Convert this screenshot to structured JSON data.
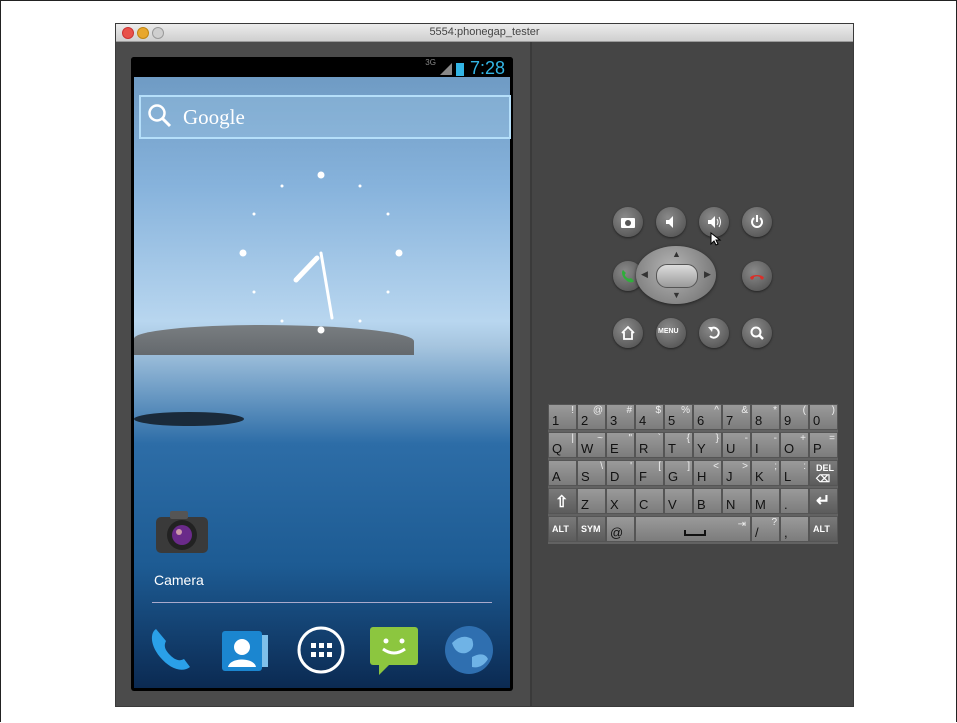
{
  "window": {
    "title": "5554:phonegap_tester"
  },
  "statusbar": {
    "network": "3G",
    "time": "7:28"
  },
  "search": {
    "label": "Google"
  },
  "desktop": {
    "camera_label": "Camera"
  },
  "dock": {
    "items": [
      "phone-icon",
      "contacts-icon",
      "all-apps-icon",
      "messaging-icon",
      "browser-icon"
    ]
  },
  "controls": {
    "menu_label": "MENU",
    "buttons": [
      "camera-icon",
      "volume-down-icon",
      "volume-up-icon",
      "power-icon",
      "call-icon",
      "end-call-icon",
      "home-icon",
      "menu",
      "back-icon",
      "search-icon"
    ]
  },
  "keyboard": {
    "row1": [
      [
        "1",
        "!"
      ],
      [
        "2",
        "@"
      ],
      [
        "3",
        "#"
      ],
      [
        "4",
        "$"
      ],
      [
        "5",
        "%"
      ],
      [
        "6",
        "^"
      ],
      [
        "7",
        "&"
      ],
      [
        "8",
        "*"
      ],
      [
        "9",
        "("
      ],
      [
        "0",
        ")"
      ]
    ],
    "row2": [
      [
        "Q",
        "|"
      ],
      [
        "W",
        "~"
      ],
      [
        "E",
        "\""
      ],
      [
        "R",
        "`"
      ],
      [
        "T",
        "{"
      ],
      [
        "Y",
        "}"
      ],
      [
        "U",
        "-"
      ],
      [
        "I",
        "-"
      ],
      [
        "O",
        "+"
      ],
      [
        "P",
        "="
      ]
    ],
    "row3": [
      [
        "A",
        ""
      ],
      [
        "S",
        "\\"
      ],
      [
        "D",
        "'"
      ],
      [
        "F",
        "["
      ],
      [
        "G",
        "]"
      ],
      [
        "H",
        "<"
      ],
      [
        "J",
        ">"
      ],
      [
        "K",
        ";"
      ],
      [
        "L",
        ":"
      ]
    ],
    "row3_del": "DEL",
    "row4": [
      [
        "Z",
        ""
      ],
      [
        "X",
        ""
      ],
      [
        "C",
        ""
      ],
      [
        "V",
        ""
      ],
      [
        "B",
        ""
      ],
      [
        "N",
        ""
      ],
      [
        "M",
        ""
      ],
      [
        ".",
        ""
      ]
    ],
    "row5": {
      "alt_left": "ALT",
      "sym": "SYM",
      "at": "@",
      "slash": "/",
      "question": "?",
      "comma": ",",
      "alt_right": "ALT"
    }
  }
}
